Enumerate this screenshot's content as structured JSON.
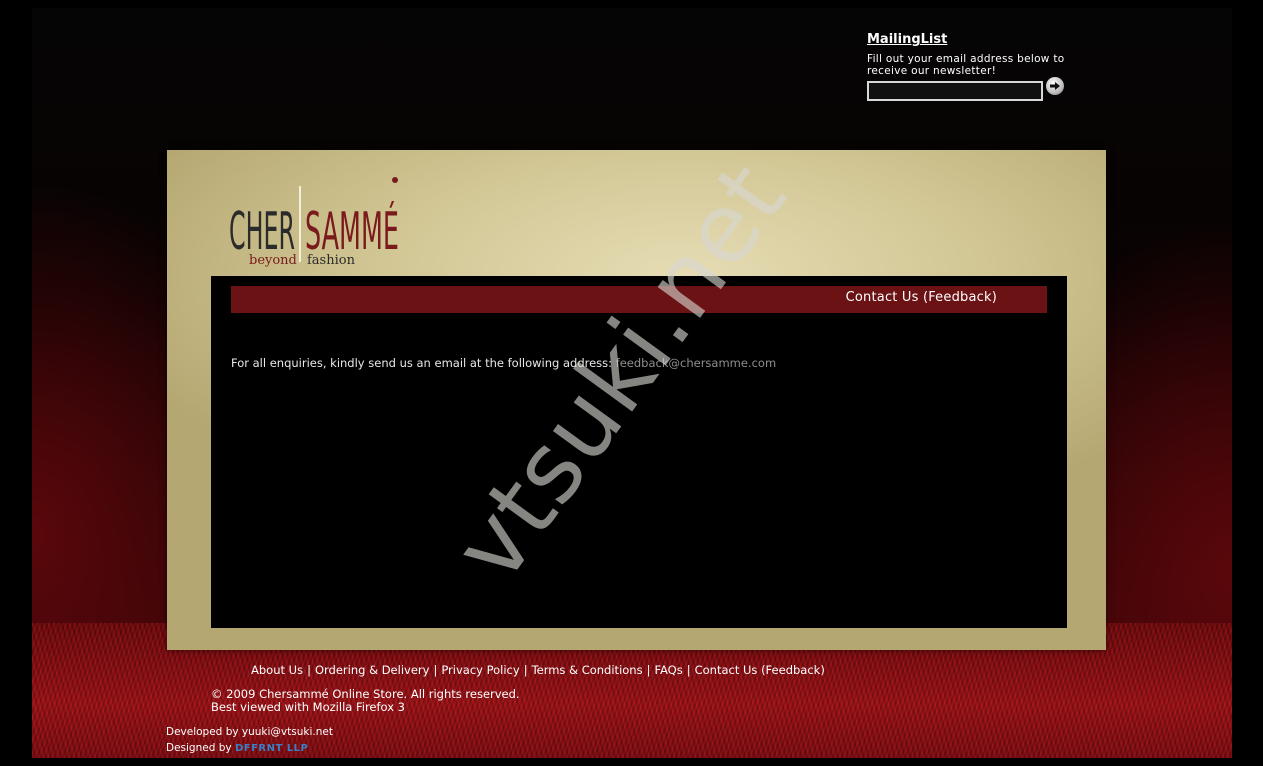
{
  "mailing_list": {
    "title": "MailingList",
    "description": "Fill out your email address below to receive our newsletter!",
    "email_value": "",
    "email_placeholder": ""
  },
  "logo": {
    "word_left": "CHER",
    "word_right": "SAMMÉ",
    "tag_left": "beyond",
    "tag_right": "fashion"
  },
  "content": {
    "title": "Contact Us (Feedback)",
    "intro": "For all enquiries, kindly send us an email at the following address: ",
    "email": "feedback@chersamme.com"
  },
  "watermark": "vtsuki.net",
  "footer": {
    "links": [
      "About Us",
      "Ordering & Delivery",
      "Privacy Policy",
      "Terms & Conditions",
      "FAQs",
      "Contact Us (Feedback)"
    ],
    "separator": "|",
    "copyright": "© 2009 Chersammé Online Store. All rights reserved.",
    "best_viewed": "Best viewed with Mozilla Firefox 3",
    "developed_label": "Developed by yuuki@vtsuki.net",
    "designed_label": "Designed by",
    "designed_brand": "DFFRNT LLP"
  },
  "colors": {
    "brand_dark_red": "#6b1214",
    "logo_red": "#7a1a1c",
    "logo_dark": "#2b2b2b",
    "card_beige": "#cfc491"
  }
}
